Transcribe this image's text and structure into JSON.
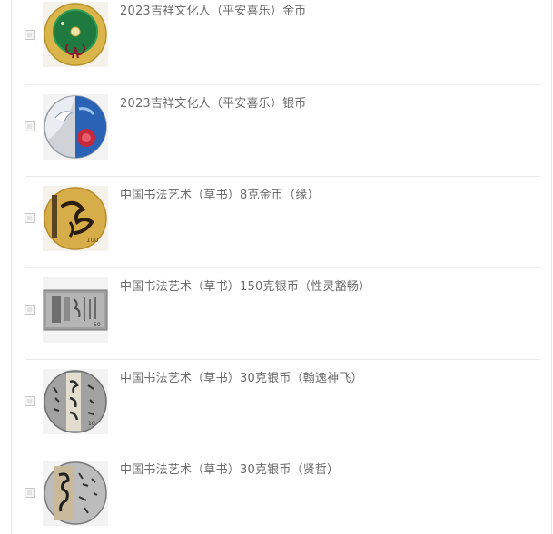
{
  "products": [
    {
      "title": "2023吉祥文化人（平安喜乐）金币",
      "image_desc": "gold-coin-green-jade",
      "denomination": ""
    },
    {
      "title": "2023吉祥文化人（平安喜乐）银币",
      "image_desc": "silver-coin-blue-cranes-red-flower",
      "denomination": ""
    },
    {
      "title": "中国书法艺术（草书）8克金币（缘）",
      "image_desc": "gold-coin-calligraphy",
      "denomination": "100"
    },
    {
      "title": "中国书法艺术（草书）150克银币（性灵豁畅）",
      "image_desc": "rectangular-silver-coin-calligraphy",
      "denomination": "50"
    },
    {
      "title": "中国书法艺术（草书）30克银币（翰逸神飞）",
      "image_desc": "silver-coin-calligraphy",
      "denomination": "10"
    },
    {
      "title": "中国书法艺术（草书）30克银币（贤哲）",
      "image_desc": "silver-coin-calligraphy",
      "denomination": ""
    }
  ],
  "colors": {
    "title_text": "#6b6b6b",
    "divider": "#e9e9e9",
    "gold": "#d8b24a",
    "silver": "#a9a9a9"
  }
}
